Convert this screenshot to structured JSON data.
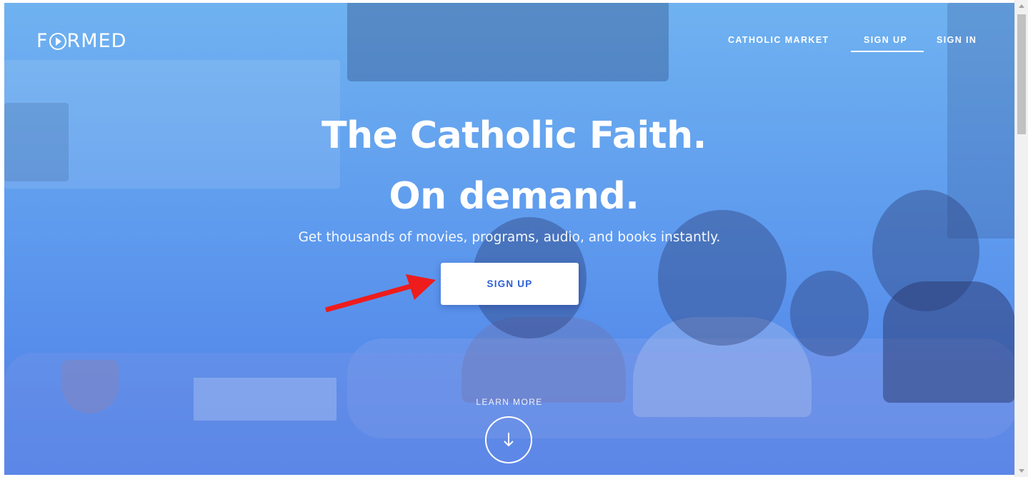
{
  "header": {
    "logo_text_before": "F",
    "logo_text_after": "RMED",
    "nav": {
      "catholic_market": "CATHOLIC MARKET",
      "sign_up": "SIGN UP",
      "sign_in": "SIGN IN"
    }
  },
  "hero": {
    "headline_line1": "The Catholic Faith.",
    "headline_line2": "On demand.",
    "tagline": "Get thousands of movies, programs, audio, and books instantly.",
    "cta_label": "SIGN UP",
    "learn_more": "LEARN MORE"
  },
  "icons": {
    "logo_o": "play-circle-icon",
    "learn_more": "arrow-down-icon",
    "annotation": "red-arrow-annotation"
  },
  "colors": {
    "cta_text": "#2d5fd6",
    "annotation": "#ee1c1c",
    "hero_top": "#6fb2f0",
    "hero_bottom": "#4e7fe8"
  }
}
